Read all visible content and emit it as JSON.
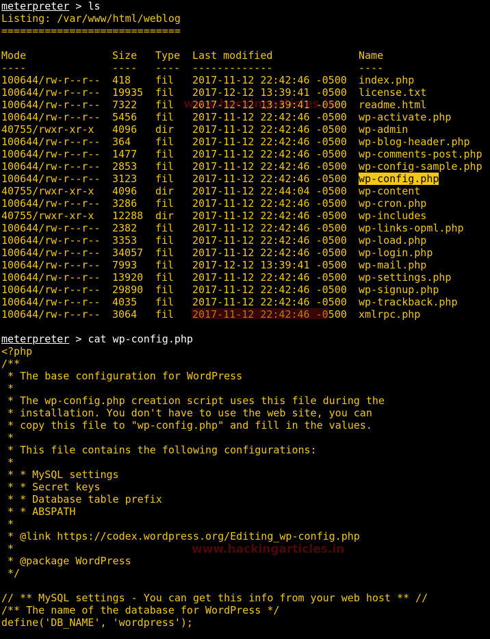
{
  "prompt": {
    "name": "meterpreter",
    "sep": " > "
  },
  "cmd1": "ls",
  "listing": "Listing: /var/www/html/weblog",
  "separator": "=============================",
  "headers": {
    "mode": "Mode",
    "size": "Size",
    "type": "Type",
    "modified": "Last modified",
    "name": "Name"
  },
  "dashes": {
    "mode": "----",
    "size": "----",
    "type": "----",
    "modified": "-------------",
    "name": "----"
  },
  "files": [
    {
      "mode": "100644/rw-r--r--",
      "size": "418",
      "type": "fil",
      "modified": "2017-11-12 22:42:46 -0500",
      "name": "index.php"
    },
    {
      "mode": "100644/rw-r--r--",
      "size": "19935",
      "type": "fil",
      "modified": "2017-12-12 13:39:41 -0500",
      "name": "license.txt"
    },
    {
      "mode": "100644/rw-r--r--",
      "size": "7322",
      "type": "fil",
      "modified": "2017-12-12 13:39:41 -0500",
      "name": "readme.html"
    },
    {
      "mode": "100644/rw-r--r--",
      "size": "5456",
      "type": "fil",
      "modified": "2017-11-12 22:42:46 -0500",
      "name": "wp-activate.php"
    },
    {
      "mode": "40755/rwxr-xr-x",
      "size": "4096",
      "type": "dir",
      "modified": "2017-11-12 22:42:46 -0500",
      "name": "wp-admin"
    },
    {
      "mode": "100644/rw-r--r--",
      "size": "364",
      "type": "fil",
      "modified": "2017-11-12 22:42:46 -0500",
      "name": "wp-blog-header.php"
    },
    {
      "mode": "100644/rw-r--r--",
      "size": "1477",
      "type": "fil",
      "modified": "2017-11-12 22:42:46 -0500",
      "name": "wp-comments-post.php"
    },
    {
      "mode": "100644/rw-r--r--",
      "size": "2853",
      "type": "fil",
      "modified": "2017-11-12 22:42:46 -0500",
      "name": "wp-config-sample.php"
    },
    {
      "mode": "100644/rw-r--r--",
      "size": "3123",
      "type": "fil",
      "modified": "2017-11-12 22:42:46 -0500",
      "name": "wp-config.php",
      "highlight": true
    },
    {
      "mode": "40755/rwxr-xr-x",
      "size": "4096",
      "type": "dir",
      "modified": "2017-11-12 22:44:04 -0500",
      "name": "wp-content"
    },
    {
      "mode": "100644/rw-r--r--",
      "size": "3286",
      "type": "fil",
      "modified": "2017-11-12 22:42:46 -0500",
      "name": "wp-cron.php"
    },
    {
      "mode": "40755/rwxr-xr-x",
      "size": "12288",
      "type": "dir",
      "modified": "2017-11-12 22:42:46 -0500",
      "name": "wp-includes"
    },
    {
      "mode": "100644/rw-r--r--",
      "size": "2382",
      "type": "fil",
      "modified": "2017-11-12 22:42:46 -0500",
      "name": "wp-links-opml.php"
    },
    {
      "mode": "100644/rw-r--r--",
      "size": "3353",
      "type": "fil",
      "modified": "2017-11-12 22:42:46 -0500",
      "name": "wp-load.php"
    },
    {
      "mode": "100644/rw-r--r--",
      "size": "34057",
      "type": "fil",
      "modified": "2017-11-12 22:42:46 -0500",
      "name": "wp-login.php"
    },
    {
      "mode": "100644/rw-r--r--",
      "size": "7993",
      "type": "fil",
      "modified": "2017-12-12 13:39:41 -0500",
      "name": "wp-mail.php"
    },
    {
      "mode": "100644/rw-r--r--",
      "size": "13920",
      "type": "fil",
      "modified": "2017-11-12 22:42:46 -0500",
      "name": "wp-settings.php"
    },
    {
      "mode": "100644/rw-r--r--",
      "size": "29890",
      "type": "fil",
      "modified": "2017-11-12 22:42:46 -0500",
      "name": "wp-signup.php"
    },
    {
      "mode": "100644/rw-r--r--",
      "size": "4035",
      "type": "fil",
      "modified": "2017-11-12 22:42:46 -0500",
      "name": "wp-trackback.php"
    },
    {
      "mode": "100644/rw-r--r--",
      "size": "3064",
      "type": "fil",
      "modified": "2017-11-12 22:42:46 -0500",
      "name": "xmlrpc.php"
    }
  ],
  "cmd2": "cat wp-config.php",
  "file_lines": [
    "<?php",
    "/**",
    " * The base configuration for WordPress",
    " *",
    " * The wp-config.php creation script uses this file during the",
    " * installation. You don't have to use the web site, you can",
    " * copy this file to \"wp-config.php\" and fill in the values.",
    " *",
    " * This file contains the following configurations:",
    " *",
    " * * MySQL settings",
    " * * Secret keys",
    " * * Database table prefix",
    " * * ABSPATH",
    " *",
    " * @link https://codex.wordpress.org/Editing_wp-config.php",
    " *",
    " * @package WordPress",
    " */",
    "",
    "// ** MySQL settings - You can get this info from your web host ** //",
    "/** The name of the database for WordPress */",
    "define('DB_NAME', 'wordpress');"
  ],
  "watermarks": [
    "www.hackingarticles.in",
    "www.hackingarticles.in"
  ],
  "colors": {
    "background": "#000000",
    "text": "#f2c716",
    "prompt": "#ffffff",
    "highlight_bg": "#f2c716",
    "watermark": "#8b0d0d"
  }
}
